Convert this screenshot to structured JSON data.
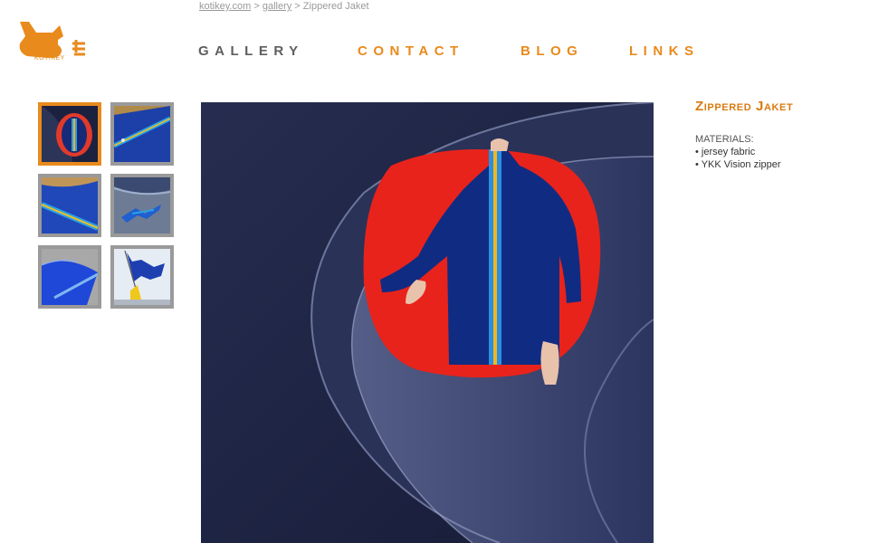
{
  "logo": {
    "text": "KOTIKEY",
    "color": "#e98a1c"
  },
  "breadcrumb": {
    "items": [
      {
        "label": "kotikey.com",
        "link": true
      },
      {
        "label": "gallery",
        "link": true
      },
      {
        "label": "Zippered Jaket",
        "link": false
      }
    ],
    "separator": ">"
  },
  "nav": {
    "items": [
      {
        "label": "GALLERY",
        "color": "#5e5e5e"
      },
      {
        "label": "CONTACT",
        "color": "#e98a1c"
      },
      {
        "label": "BLOG",
        "color": "#e98a1c"
      },
      {
        "label": "LINKS",
        "color": "#e98a1c"
      }
    ]
  },
  "thumbnails": [
    {
      "name": "thumb-jacket-collar",
      "active": true
    },
    {
      "name": "thumb-jacket-sleeve",
      "active": false
    },
    {
      "name": "thumb-jacket-zipper-stripe",
      "active": false
    },
    {
      "name": "thumb-jacket-on-beach",
      "active": false
    },
    {
      "name": "thumb-jacket-blue-fabric",
      "active": false
    },
    {
      "name": "thumb-jacket-flag-sky",
      "active": false
    }
  ],
  "product": {
    "title": "Zippered Jaket",
    "materials_label": "MATERIALS:",
    "materials": [
      "jersey fabric",
      "YKK Vision zipper"
    ]
  },
  "colors": {
    "accent": "#e98a1c",
    "thumb_border": "#9a9a9a",
    "title": "#d97a10"
  }
}
